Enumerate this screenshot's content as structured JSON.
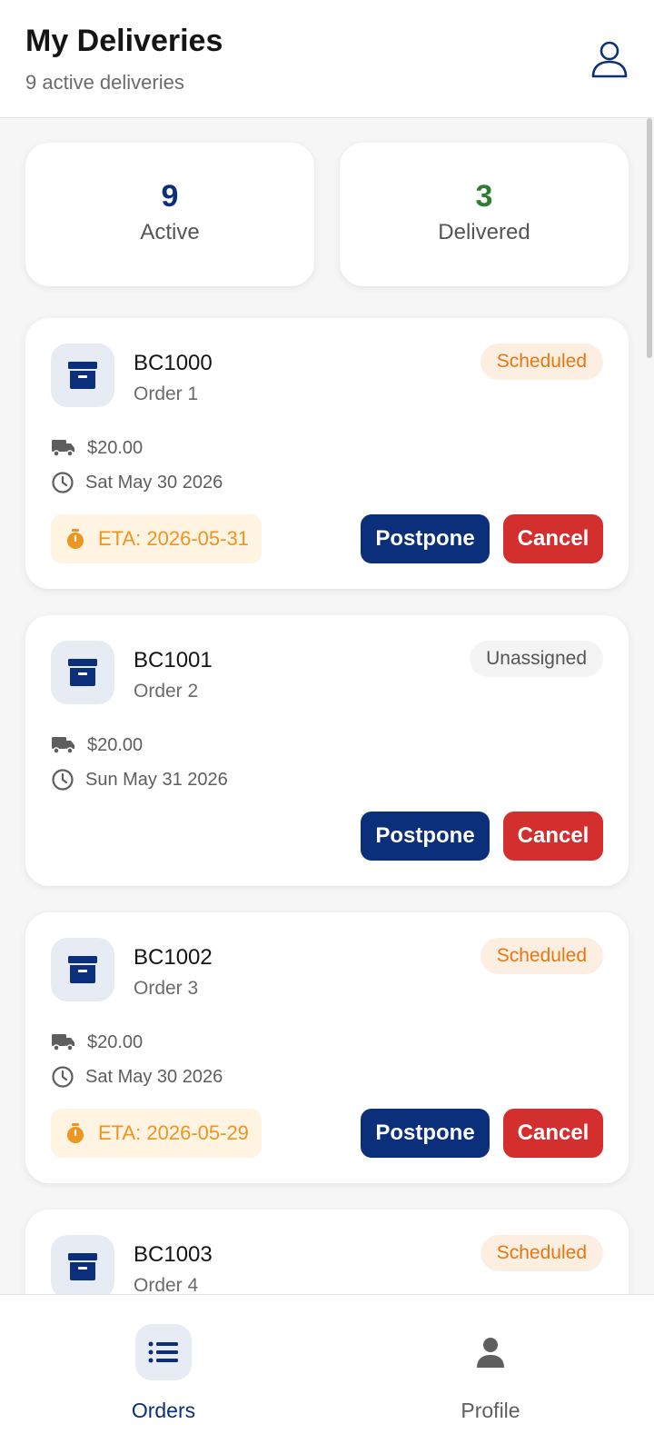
{
  "header": {
    "title": "My Deliveries",
    "subtitle": "9 active deliveries",
    "profile_icon": "user-outline-icon"
  },
  "stats": [
    {
      "value": "9",
      "label": "Active",
      "color": "#0b2f7a"
    },
    {
      "value": "3",
      "label": "Delivered",
      "color": "#2e7d32"
    }
  ],
  "deliveries": [
    {
      "code": "BC1000",
      "name": "Order 1",
      "status": "Scheduled",
      "price": "$20.00",
      "date": "Sat May 30 2026",
      "eta": "ETA: 2026-05-31",
      "postpone_label": "Postpone",
      "cancel_label": "Cancel"
    },
    {
      "code": "BC1001",
      "name": "Order 2",
      "status": "Unassigned",
      "price": "$20.00",
      "date": "Sun May 31 2026",
      "eta": "",
      "postpone_label": "Postpone",
      "cancel_label": "Cancel"
    },
    {
      "code": "BC1002",
      "name": "Order 3",
      "status": "Scheduled",
      "price": "$20.00",
      "date": "Sat May 30 2026",
      "eta": "ETA: 2026-05-29",
      "postpone_label": "Postpone",
      "cancel_label": "Cancel"
    },
    {
      "code": "BC1003",
      "name": "Order 4",
      "status": "Scheduled"
    }
  ],
  "nav": {
    "orders_label": "Orders",
    "profile_label": "Profile",
    "active": "orders"
  },
  "colors": {
    "primary": "#0b2f7a",
    "danger": "#d32f2f",
    "scheduled": "#e7770f",
    "eta": "#ee9521"
  }
}
